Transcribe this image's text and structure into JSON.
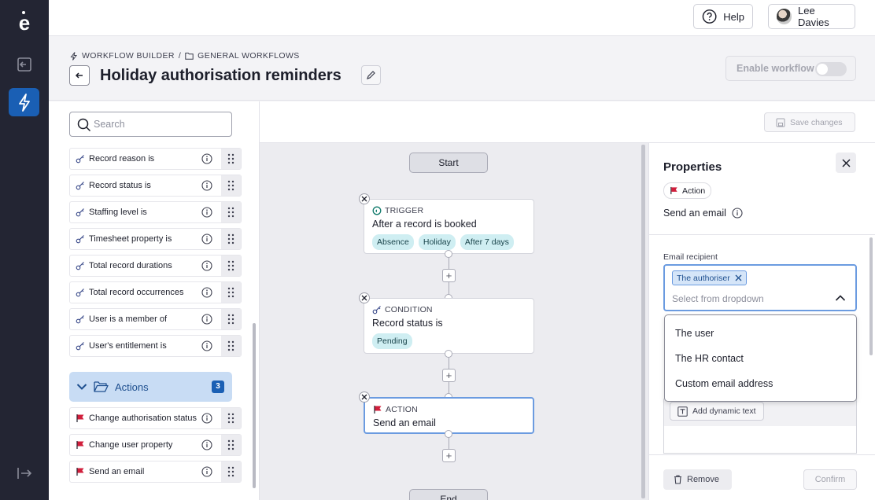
{
  "app": {
    "logo_text": "e"
  },
  "topbar": {
    "help_label": "Help",
    "user_name": "Lee Davies"
  },
  "breadcrumb": {
    "root": "WORKFLOW BUILDER",
    "separator": "/",
    "folder": "GENERAL WORKFLOWS"
  },
  "page": {
    "title": "Holiday authorisation reminders"
  },
  "enable": {
    "label": "Enable workflow",
    "enabled": false
  },
  "search": {
    "placeholder": "Search"
  },
  "palette": {
    "conditions": [
      "Record reason is",
      "Record status is",
      "Staffing level is",
      "Timesheet property is",
      "Total record durations",
      "Total record occurrences",
      "User is a member of",
      "User's entitlement is"
    ],
    "actions_header": {
      "label": "Actions",
      "count": "3"
    },
    "actions": [
      "Change authorisation status",
      "Change user property",
      "Send an email"
    ]
  },
  "toolbar": {
    "save_label": "Save changes"
  },
  "canvas": {
    "start_label": "Start",
    "end_label": "End",
    "trigger": {
      "kind": "TRIGGER",
      "title": "After a record is booked",
      "tags": [
        "Absence",
        "Holiday",
        "After 7 days"
      ]
    },
    "condition": {
      "kind": "CONDITION",
      "title": "Record status is",
      "tags": [
        "Pending"
      ]
    },
    "action": {
      "kind": "ACTION",
      "title": "Send an email"
    }
  },
  "properties": {
    "title": "Properties",
    "type_badge": "Action",
    "subtitle": "Send an email",
    "recipient_label": "Email recipient",
    "selected_recipient": "The authoriser",
    "recipient_placeholder": "Select from dropdown",
    "dropdown_options": [
      "The user",
      "The HR contact",
      "Custom email address"
    ],
    "dynamic_text_label": "Add dynamic text",
    "remove_label": "Remove",
    "confirm_label": "Confirm"
  },
  "colors": {
    "rail": "#232533",
    "accent": "#1a5fb4",
    "flag": "#d11f3c",
    "tag": "#cfeef2"
  }
}
